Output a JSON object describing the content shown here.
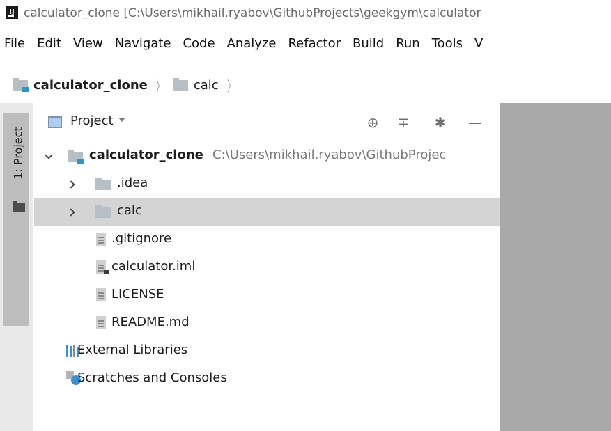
{
  "window": {
    "app_icon_text": "IJ",
    "title": "calculator_clone [C:\\Users\\mikhail.ryabov\\GithubProjects\\geekgym\\calculator"
  },
  "menu": {
    "items": [
      "File",
      "Edit",
      "View",
      "Navigate",
      "Code",
      "Analyze",
      "Refactor",
      "Build",
      "Run",
      "Tools",
      "V"
    ]
  },
  "breadcrumb": {
    "items": [
      "calculator_clone",
      "calc"
    ]
  },
  "tool_stripe": {
    "label": "1: Project"
  },
  "project_panel": {
    "view_label": "Project",
    "icons": {
      "locate": "crosshair-icon",
      "collapse": "collapse-all-icon",
      "settings": "gear-icon",
      "hide": "minimize-icon"
    }
  },
  "tree": {
    "root": {
      "name": "calculator_clone",
      "path": "C:\\Users\\mikhail.ryabov\\GithubProjec"
    },
    "folders": [
      ".idea",
      "calc"
    ],
    "files": [
      ".gitignore",
      "calculator.iml",
      "LICENSE",
      "README.md"
    ],
    "external_libraries": "External Libraries",
    "scratches": "Scratches and Consoles"
  },
  "colors": {
    "selected_row": "#d4d4d4",
    "editor_background": "#a9a9a9",
    "module_accent": "#3592c4"
  }
}
